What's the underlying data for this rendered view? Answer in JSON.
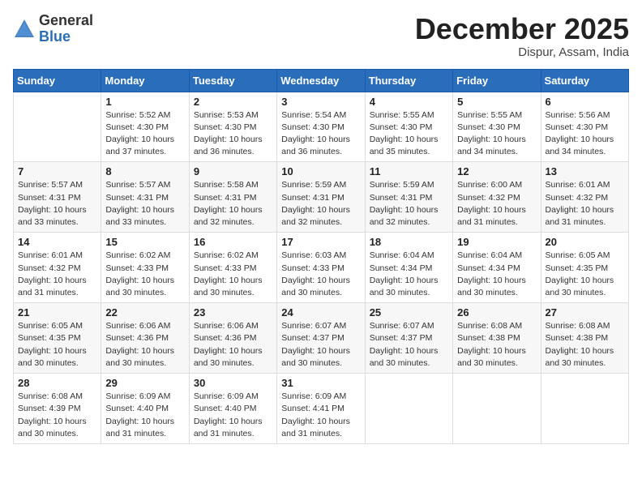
{
  "header": {
    "logo_general": "General",
    "logo_blue": "Blue",
    "month_title": "December 2025",
    "subtitle": "Dispur, Assam, India"
  },
  "days_of_week": [
    "Sunday",
    "Monday",
    "Tuesday",
    "Wednesday",
    "Thursday",
    "Friday",
    "Saturday"
  ],
  "weeks": [
    [
      {
        "day": "",
        "info": ""
      },
      {
        "day": "1",
        "info": "Sunrise: 5:52 AM\nSunset: 4:30 PM\nDaylight: 10 hours\nand 37 minutes."
      },
      {
        "day": "2",
        "info": "Sunrise: 5:53 AM\nSunset: 4:30 PM\nDaylight: 10 hours\nand 36 minutes."
      },
      {
        "day": "3",
        "info": "Sunrise: 5:54 AM\nSunset: 4:30 PM\nDaylight: 10 hours\nand 36 minutes."
      },
      {
        "day": "4",
        "info": "Sunrise: 5:55 AM\nSunset: 4:30 PM\nDaylight: 10 hours\nand 35 minutes."
      },
      {
        "day": "5",
        "info": "Sunrise: 5:55 AM\nSunset: 4:30 PM\nDaylight: 10 hours\nand 34 minutes."
      },
      {
        "day": "6",
        "info": "Sunrise: 5:56 AM\nSunset: 4:30 PM\nDaylight: 10 hours\nand 34 minutes."
      }
    ],
    [
      {
        "day": "7",
        "info": "Sunrise: 5:57 AM\nSunset: 4:31 PM\nDaylight: 10 hours\nand 33 minutes."
      },
      {
        "day": "8",
        "info": "Sunrise: 5:57 AM\nSunset: 4:31 PM\nDaylight: 10 hours\nand 33 minutes."
      },
      {
        "day": "9",
        "info": "Sunrise: 5:58 AM\nSunset: 4:31 PM\nDaylight: 10 hours\nand 32 minutes."
      },
      {
        "day": "10",
        "info": "Sunrise: 5:59 AM\nSunset: 4:31 PM\nDaylight: 10 hours\nand 32 minutes."
      },
      {
        "day": "11",
        "info": "Sunrise: 5:59 AM\nSunset: 4:31 PM\nDaylight: 10 hours\nand 32 minutes."
      },
      {
        "day": "12",
        "info": "Sunrise: 6:00 AM\nSunset: 4:32 PM\nDaylight: 10 hours\nand 31 minutes."
      },
      {
        "day": "13",
        "info": "Sunrise: 6:01 AM\nSunset: 4:32 PM\nDaylight: 10 hours\nand 31 minutes."
      }
    ],
    [
      {
        "day": "14",
        "info": "Sunrise: 6:01 AM\nSunset: 4:32 PM\nDaylight: 10 hours\nand 31 minutes."
      },
      {
        "day": "15",
        "info": "Sunrise: 6:02 AM\nSunset: 4:33 PM\nDaylight: 10 hours\nand 30 minutes."
      },
      {
        "day": "16",
        "info": "Sunrise: 6:02 AM\nSunset: 4:33 PM\nDaylight: 10 hours\nand 30 minutes."
      },
      {
        "day": "17",
        "info": "Sunrise: 6:03 AM\nSunset: 4:33 PM\nDaylight: 10 hours\nand 30 minutes."
      },
      {
        "day": "18",
        "info": "Sunrise: 6:04 AM\nSunset: 4:34 PM\nDaylight: 10 hours\nand 30 minutes."
      },
      {
        "day": "19",
        "info": "Sunrise: 6:04 AM\nSunset: 4:34 PM\nDaylight: 10 hours\nand 30 minutes."
      },
      {
        "day": "20",
        "info": "Sunrise: 6:05 AM\nSunset: 4:35 PM\nDaylight: 10 hours\nand 30 minutes."
      }
    ],
    [
      {
        "day": "21",
        "info": "Sunrise: 6:05 AM\nSunset: 4:35 PM\nDaylight: 10 hours\nand 30 minutes."
      },
      {
        "day": "22",
        "info": "Sunrise: 6:06 AM\nSunset: 4:36 PM\nDaylight: 10 hours\nand 30 minutes."
      },
      {
        "day": "23",
        "info": "Sunrise: 6:06 AM\nSunset: 4:36 PM\nDaylight: 10 hours\nand 30 minutes."
      },
      {
        "day": "24",
        "info": "Sunrise: 6:07 AM\nSunset: 4:37 PM\nDaylight: 10 hours\nand 30 minutes."
      },
      {
        "day": "25",
        "info": "Sunrise: 6:07 AM\nSunset: 4:37 PM\nDaylight: 10 hours\nand 30 minutes."
      },
      {
        "day": "26",
        "info": "Sunrise: 6:08 AM\nSunset: 4:38 PM\nDaylight: 10 hours\nand 30 minutes."
      },
      {
        "day": "27",
        "info": "Sunrise: 6:08 AM\nSunset: 4:38 PM\nDaylight: 10 hours\nand 30 minutes."
      }
    ],
    [
      {
        "day": "28",
        "info": "Sunrise: 6:08 AM\nSunset: 4:39 PM\nDaylight: 10 hours\nand 30 minutes."
      },
      {
        "day": "29",
        "info": "Sunrise: 6:09 AM\nSunset: 4:40 PM\nDaylight: 10 hours\nand 31 minutes."
      },
      {
        "day": "30",
        "info": "Sunrise: 6:09 AM\nSunset: 4:40 PM\nDaylight: 10 hours\nand 31 minutes."
      },
      {
        "day": "31",
        "info": "Sunrise: 6:09 AM\nSunset: 4:41 PM\nDaylight: 10 hours\nand 31 minutes."
      },
      {
        "day": "",
        "info": ""
      },
      {
        "day": "",
        "info": ""
      },
      {
        "day": "",
        "info": ""
      }
    ]
  ]
}
